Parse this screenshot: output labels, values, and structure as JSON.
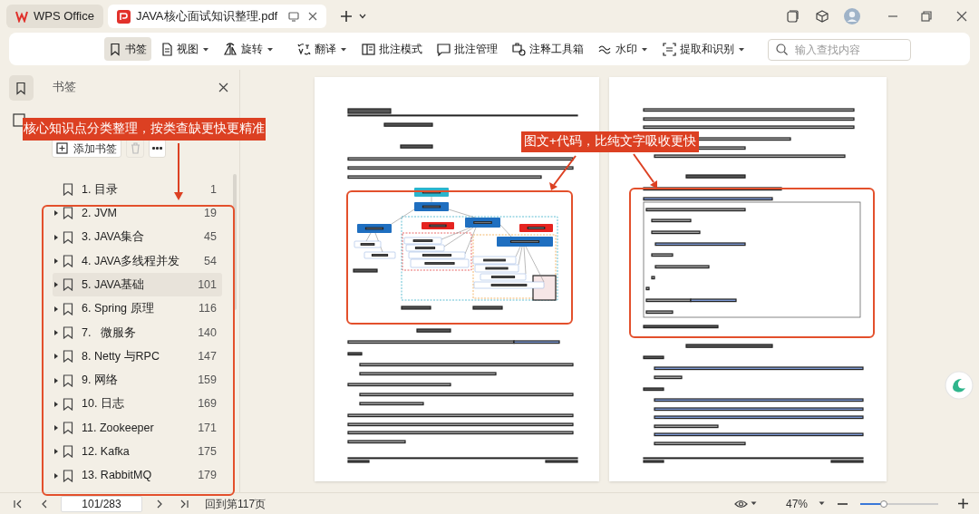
{
  "tabs": [
    {
      "kind": "home",
      "label": "WPS Office",
      "selected": false
    },
    {
      "kind": "document",
      "label": "JAVA核心面试知识整理.pdf",
      "selected": true
    }
  ],
  "toolbar": {
    "groups": [
      [
        {
          "label": "书签",
          "dropdown": false,
          "selected": true
        },
        {
          "label": "视图",
          "dropdown": true,
          "selected": false
        },
        {
          "label": "旋转",
          "dropdown": true,
          "selected": false
        }
      ],
      [
        {
          "label": "翻译",
          "dropdown": true,
          "selected": false
        },
        {
          "label": "批注模式",
          "dropdown": false,
          "selected": false
        },
        {
          "label": "批注管理",
          "dropdown": false,
          "selected": false
        },
        {
          "label": "注释工具箱",
          "dropdown": false,
          "selected": false
        },
        {
          "label": "水印",
          "dropdown": true,
          "selected": false
        },
        {
          "label": "提取和识别",
          "dropdown": true,
          "selected": false
        }
      ]
    ],
    "search": {
      "placeholder": "输入查找内容"
    }
  },
  "bookmarks": {
    "title": "书签",
    "add_label": "添加书签",
    "items": [
      {
        "label": "1. 目录",
        "page": "1",
        "expandable": false,
        "selected": false
      },
      {
        "label": "2. JVM",
        "page": "19",
        "expandable": true,
        "selected": false
      },
      {
        "label": "3. JAVA集合",
        "page": "45",
        "expandable": true,
        "selected": false
      },
      {
        "label": "4. JAVA多线程并发",
        "page": "54",
        "expandable": true,
        "selected": false
      },
      {
        "label": "5. JAVA基础",
        "page": "101",
        "expandable": true,
        "selected": true
      },
      {
        "label": "6. Spring 原理",
        "page": "116",
        "expandable": true,
        "selected": false
      },
      {
        "label": "7.   微服务",
        "page": "140",
        "expandable": true,
        "selected": false
      },
      {
        "label": "8. Netty 与RPC",
        "page": "147",
        "expandable": true,
        "selected": false
      },
      {
        "label": "9. 网络",
        "page": "159",
        "expandable": true,
        "selected": false
      },
      {
        "label": "10. 日志",
        "page": "169",
        "expandable": true,
        "selected": false
      },
      {
        "label": "11. Zookeeper",
        "page": "171",
        "expandable": true,
        "selected": false
      },
      {
        "label": "12. Kafka",
        "page": "175",
        "expandable": true,
        "selected": false
      },
      {
        "label": "13. RabbitMQ",
        "page": "179",
        "expandable": true,
        "selected": false
      }
    ]
  },
  "annotations": [
    {
      "text": "核心知识点分类整理，按类查缺更快更精准"
    },
    {
      "text": "图文+代码，比纯文字吸收更快"
    }
  ],
  "status_bar": {
    "page_input": "101/283",
    "goto": "回到第117页",
    "zoom": "47%",
    "level": 0.3
  }
}
